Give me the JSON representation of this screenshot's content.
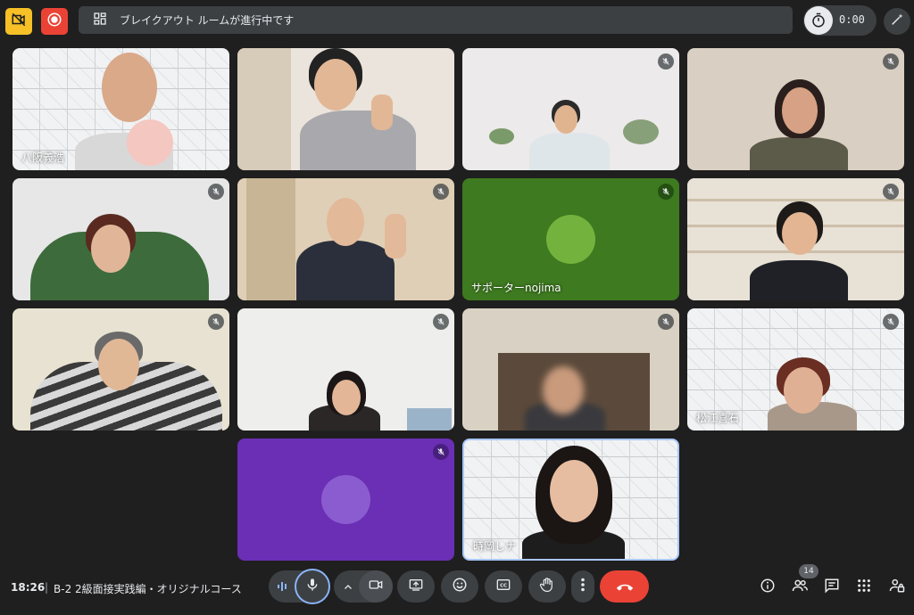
{
  "top_bar": {
    "banner_text": "ブレイクアウト ルームが進行中です",
    "timer": "0:00"
  },
  "tiles": {
    "t1": {
      "name": "八阪義浩",
      "muted": false
    },
    "t2": {
      "name": "",
      "muted": false
    },
    "t3": {
      "name": "",
      "muted": true
    },
    "t4": {
      "name": "",
      "muted": true
    },
    "t5": {
      "name": "",
      "muted": true
    },
    "t6": {
      "name": "",
      "muted": true
    },
    "t7": {
      "name": "サポーターnojima",
      "muted": true
    },
    "t8": {
      "name": "",
      "muted": true
    },
    "t9": {
      "name": "",
      "muted": true
    },
    "t10": {
      "name": "",
      "muted": true
    },
    "t11": {
      "name": "",
      "muted": true
    },
    "t12": {
      "name": "松江喜石",
      "muted": true
    },
    "t13": {
      "name": "",
      "muted": true
    },
    "t14": {
      "name": "時岡しナ",
      "muted": false
    }
  },
  "bottom_bar": {
    "time": "18:26",
    "separator": "|",
    "meeting_title": "B-2 2級面接実践編・オリジナルコース",
    "participants_count": "14"
  },
  "colors": {
    "background": "#1f1f1f",
    "control_bg": "#3c4043",
    "hangup": "#ea4335",
    "active_ring": "#8ab4f8",
    "green_tile": "#3e7a20",
    "purple_tile": "#6a2fb5"
  },
  "icons": [
    "camera-off-icon",
    "record-icon",
    "layout-icon",
    "timer-icon",
    "magic-wand-icon",
    "mic-off-icon",
    "audio-wave-icon",
    "mic-icon",
    "chevron-up-icon",
    "camera-icon",
    "present-icon",
    "emoji-icon",
    "captions-icon",
    "hand-icon",
    "more-vert-icon",
    "hangup-icon",
    "info-icon",
    "people-icon",
    "chat-icon",
    "apps-icon",
    "lock-person-icon"
  ]
}
